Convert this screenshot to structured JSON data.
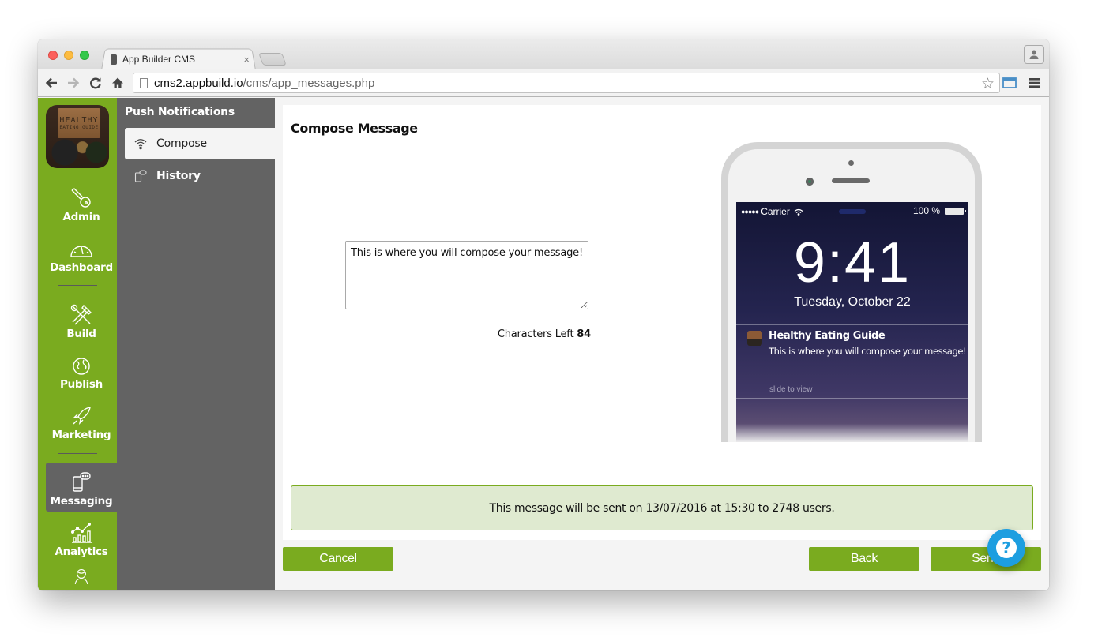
{
  "browser": {
    "tab_title": "App Builder CMS",
    "tab_close": "×",
    "url_host": "cms2.appbuild.io",
    "url_path": "/cms/app_messages.php"
  },
  "app": {
    "logo": {
      "line1": "HEALTHY",
      "line2": "EATING GUIDE"
    },
    "rail": {
      "items": [
        {
          "label": "Admin",
          "icon": "key-icon"
        },
        {
          "label": "Dashboard",
          "icon": "gauge-icon"
        },
        {
          "label": "Build",
          "icon": "tools-icon"
        },
        {
          "label": "Publish",
          "icon": "globe-icon"
        },
        {
          "label": "Marketing",
          "icon": "rocket-icon"
        },
        {
          "label": "Messaging",
          "icon": "phone-chat-icon",
          "active": true
        },
        {
          "label": "Analytics",
          "icon": "chart-icon"
        },
        {
          "label": "",
          "icon": "user-icon"
        }
      ]
    },
    "subnav": {
      "title": "Push Notifications",
      "items": [
        {
          "label": "Compose",
          "icon": "wifi-icon",
          "active": true
        },
        {
          "label": "History",
          "icon": "phone-chat-icon"
        }
      ]
    },
    "compose": {
      "title": "Compose Message",
      "message_value": "This is where you will compose your message!",
      "chars_left_label": "Characters Left",
      "chars_left_value": "84"
    },
    "phone_preview": {
      "carrier": "Carrier",
      "battery": "100 %",
      "time": "9:41",
      "date": "Tuesday, October 22",
      "notification_title": "Healthy Eating Guide",
      "notification_body": "This is where you will compose your message!",
      "slide_hint": "slide to view"
    },
    "notice": "This message will be sent on 13/07/2016 at 15:30 to 2748 users.",
    "buttons": {
      "cancel": "Cancel",
      "back": "Back",
      "send": "Send"
    },
    "help": "?"
  }
}
